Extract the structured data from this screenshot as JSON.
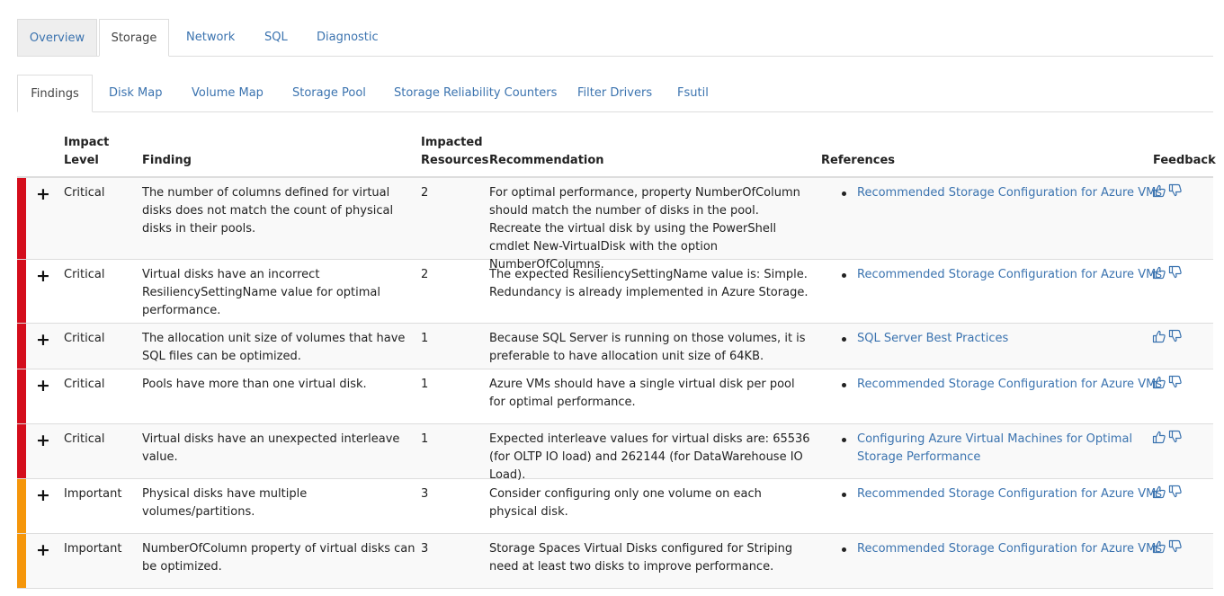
{
  "top_tabs": [
    "Overview",
    "Storage",
    "Network",
    "SQL",
    "Diagnostic"
  ],
  "sub_tabs": [
    "Findings",
    "Disk Map",
    "Volume Map",
    "Storage Pool",
    "Storage Reliability Counters",
    "Filter Drivers",
    "Fsutil"
  ],
  "headers": {
    "impact_line1": "Impact",
    "impact_line2": "Level",
    "finding": "Finding",
    "impacted_line1": "Impacted",
    "impacted_line2": "Resources",
    "recommendation": "Recommendation",
    "references": "References",
    "feedback": "Feedback"
  },
  "colors": {
    "critical": "#d40d1c",
    "important": "#f5960a",
    "link": "#3b73af"
  },
  "rows": [
    {
      "level": "Critical",
      "finding": "The number of columns defined for virtual disks does not match the count of physical disks in their pools.",
      "resources": "2",
      "recommendation": "For optimal performance, property NumberOfColumn should match the number of disks in the pool. Recreate the virtual disk by using the PowerShell cmdlet New-VirtualDisk with the option NumberOfColumns.",
      "reference": "Recommended Storage Configuration for Azure VMs"
    },
    {
      "level": "Critical",
      "finding": "Virtual disks have an incorrect ResiliencySettingName value for optimal performance.",
      "resources": "2",
      "recommendation": "The expected ResiliencySettingName value is: Simple. Redundancy is already implemented in Azure Storage.",
      "reference": "Recommended Storage Configuration for Azure VMs"
    },
    {
      "level": "Critical",
      "finding": "The allocation unit size of volumes that have SQL files can be optimized.",
      "resources": "1",
      "recommendation": "Because SQL Server is running on those volumes, it is preferable to have allocation unit size of 64KB.",
      "reference": "SQL Server Best Practices"
    },
    {
      "level": "Critical",
      "finding": "Pools have more than one virtual disk.",
      "resources": "1",
      "recommendation": "Azure VMs should have a single virtual disk per pool for optimal performance.",
      "reference": "Recommended Storage Configuration for Azure VMs"
    },
    {
      "level": "Critical",
      "finding": "Virtual disks have an unexpected interleave value.",
      "resources": "1",
      "recommendation": "Expected interleave values for virtual disks are: 65536 (for OLTP IO load) and 262144 (for DataWarehouse IO Load).",
      "reference": "Configuring Azure Virtual Machines for Optimal Storage Performance"
    },
    {
      "level": "Important",
      "finding": "Physical disks have multiple volumes/partitions.",
      "resources": "3",
      "recommendation": "Consider configuring only one volume on each physical disk.",
      "reference": "Recommended Storage Configuration for Azure VMs"
    },
    {
      "level": "Important",
      "finding": "NumberOfColumn property of virtual disks can be optimized.",
      "resources": "3",
      "recommendation": "Storage Spaces Virtual Disks configured for Striping need at least two disks to improve performance.",
      "reference": "Recommended Storage Configuration for Azure VMs"
    }
  ]
}
